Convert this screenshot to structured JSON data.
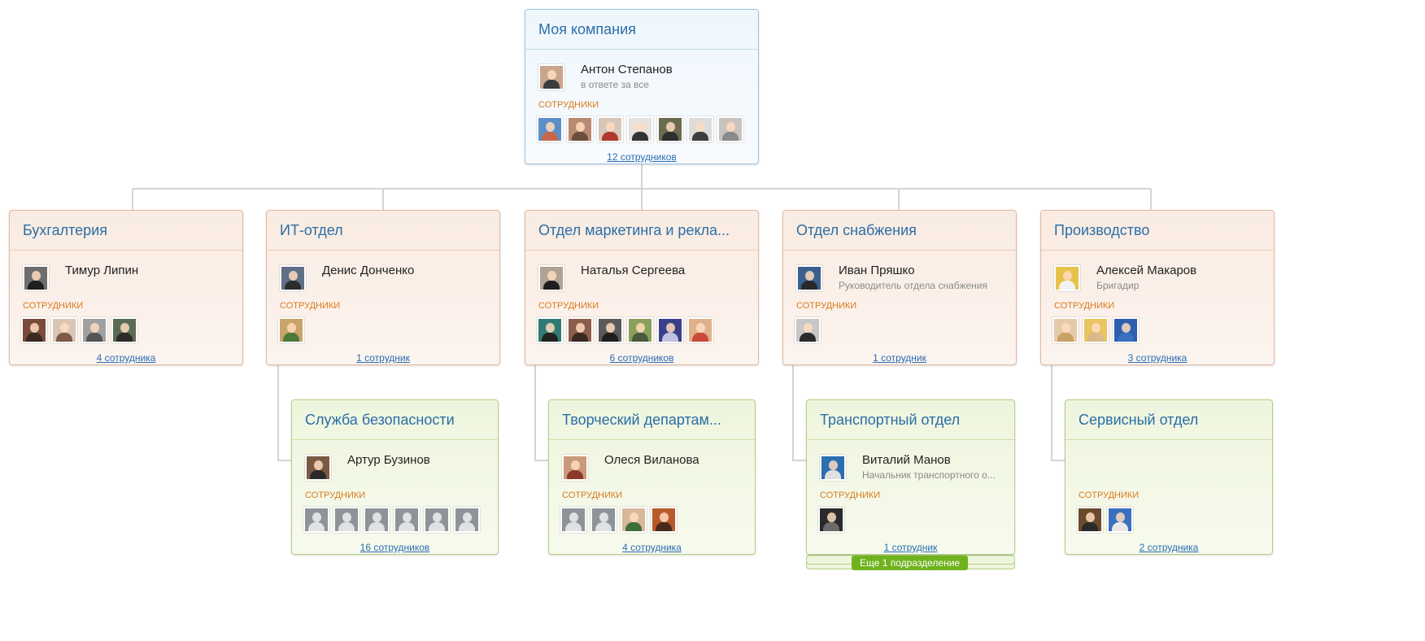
{
  "root": {
    "title": "Моя компания",
    "head": {
      "name": "Антон Степанов",
      "position": "в ответе за все",
      "photo": [
        "#c9a58c",
        "#3b3b3b"
      ]
    },
    "employees_label": "СОТРУДНИКИ",
    "photos": [
      [
        "#5d8fc7",
        "#c8684a"
      ],
      [
        "#b98a6f",
        "#6a4e3e"
      ],
      [
        "#d7c7b9",
        "#b03a2e"
      ],
      [
        "#e6e2dc",
        "#333333"
      ],
      [
        "#6b6b4f",
        "#2f2f2f"
      ],
      [
        "#dcdcdc",
        "#3e3e3e"
      ],
      [
        "#c8c3bd",
        "#8a8a8a"
      ]
    ],
    "count": "12 сотрудников"
  },
  "departments": [
    {
      "title": "Бухгалтерия",
      "head": {
        "name": "Тимур Липин",
        "position": "",
        "photo": [
          "#6d6d6d",
          "#1f1f1f"
        ]
      },
      "employees_label": "СОТРУДНИКИ",
      "photos": [
        [
          "#7a4b3a",
          "#3b2a22"
        ],
        [
          "#d9c6b5",
          "#7d5b47"
        ],
        [
          "#a0a0a0",
          "#555555"
        ],
        [
          "#5b6b52",
          "#2b2b2b"
        ]
      ],
      "count": "4 сотрудника"
    },
    {
      "title": "ИТ-отдел",
      "head": {
        "name": "Денис Донченко",
        "position": "",
        "photo": [
          "#5e6f86",
          "#2c2c2c"
        ]
      },
      "employees_label": "СОТРУДНИКИ",
      "photos": [
        [
          "#c9a46a",
          "#4d7a3a"
        ]
      ],
      "count": "1 сотрудник"
    },
    {
      "title": "Отдел маркетинга и рекла...",
      "head": {
        "name": "Наталья Сергеева",
        "position": "",
        "photo": [
          "#b1a394",
          "#1e1e1e"
        ]
      },
      "employees_label": "СОТРУДНИКИ",
      "photos": [
        [
          "#2f7b73",
          "#222222"
        ],
        [
          "#8b5d4a",
          "#3a2a22"
        ],
        [
          "#5a5a5a",
          "#1e1e1e"
        ],
        [
          "#8aa05a",
          "#4a5a3a"
        ],
        [
          "#3b3f8a",
          "#c0c0e0"
        ],
        [
          "#e0b08a",
          "#c84a3a"
        ]
      ],
      "count": "6 сотрудников"
    },
    {
      "title": "Отдел снабжения",
      "head": {
        "name": "Иван Пряшко",
        "position": "Руководитель отдела снабжения",
        "photo": [
          "#3a5f8f",
          "#2a2a2a"
        ]
      },
      "employees_label": "СОТРУДНИКИ",
      "photos": [
        [
          "#c7c7c7",
          "#2b2b2b"
        ]
      ],
      "count": "1 сотрудник"
    },
    {
      "title": "Производство",
      "head": {
        "name": "Алексей Макаров",
        "position": "Бригадир",
        "photo": [
          "#e6c24a",
          "#f2f2f2"
        ]
      },
      "employees_label": "СОТРУДНИКИ",
      "photos": [
        [
          "#e4cba8",
          "#c9a266"
        ],
        [
          "#e8c560",
          "#d9b88e"
        ],
        [
          "#2d5fae",
          "#3b6fbf"
        ]
      ],
      "count": "3 сотрудника"
    }
  ],
  "subdepartments": [
    {
      "title": "Служба безопасности",
      "head": {
        "name": "Артур Бузинов",
        "position": "",
        "photo": [
          "#7a5a45",
          "#2a2a2a"
        ]
      },
      "employees_label": "СОТРУДНИКИ",
      "photos": [
        "placeholder",
        "placeholder",
        "placeholder",
        "placeholder",
        "placeholder",
        "placeholder"
      ],
      "count": "16 сотрудников"
    },
    {
      "title": "Творческий департам...",
      "head": {
        "name": "Олеся Виланова",
        "position": "",
        "photo": [
          "#c99a7a",
          "#8a3a2a"
        ]
      },
      "employees_label": "СОТРУДНИКИ",
      "photos": [
        "placeholder",
        "placeholder",
        [
          "#d8b89a",
          "#3e6f3a"
        ],
        [
          "#b85a2a",
          "#4a2a1a"
        ]
      ],
      "count": "4 сотрудника"
    },
    {
      "title": "Транспортный отдел",
      "head": {
        "name": "Виталий Манов",
        "position": "Начальник транспортного о...",
        "photo": [
          "#2a6fb0",
          "#e0e0e0"
        ]
      },
      "employees_label": "СОТРУДНИКИ",
      "photos": [
        [
          "#2a2a2a",
          "#6a6a6a"
        ]
      ],
      "count": "1 сотрудник",
      "more": "Еще 1 подразделение"
    },
    {
      "title": "Сервисный отдел",
      "head": null,
      "employees_label": "СОТРУДНИКИ",
      "photos": [
        [
          "#6a4a2a",
          "#2a2a2a"
        ],
        [
          "#3a6fc0",
          "#e8e8e8"
        ]
      ],
      "count": "2 сотрудника"
    }
  ],
  "colors": {
    "link": "#2a6db2",
    "title": "#2b6ea8",
    "label": "#d87a1a",
    "more_badge": "#6fb21e",
    "line": "#d4d4d4"
  },
  "icons": {
    "placeholder_avatar": "user-silhouette-icon"
  }
}
